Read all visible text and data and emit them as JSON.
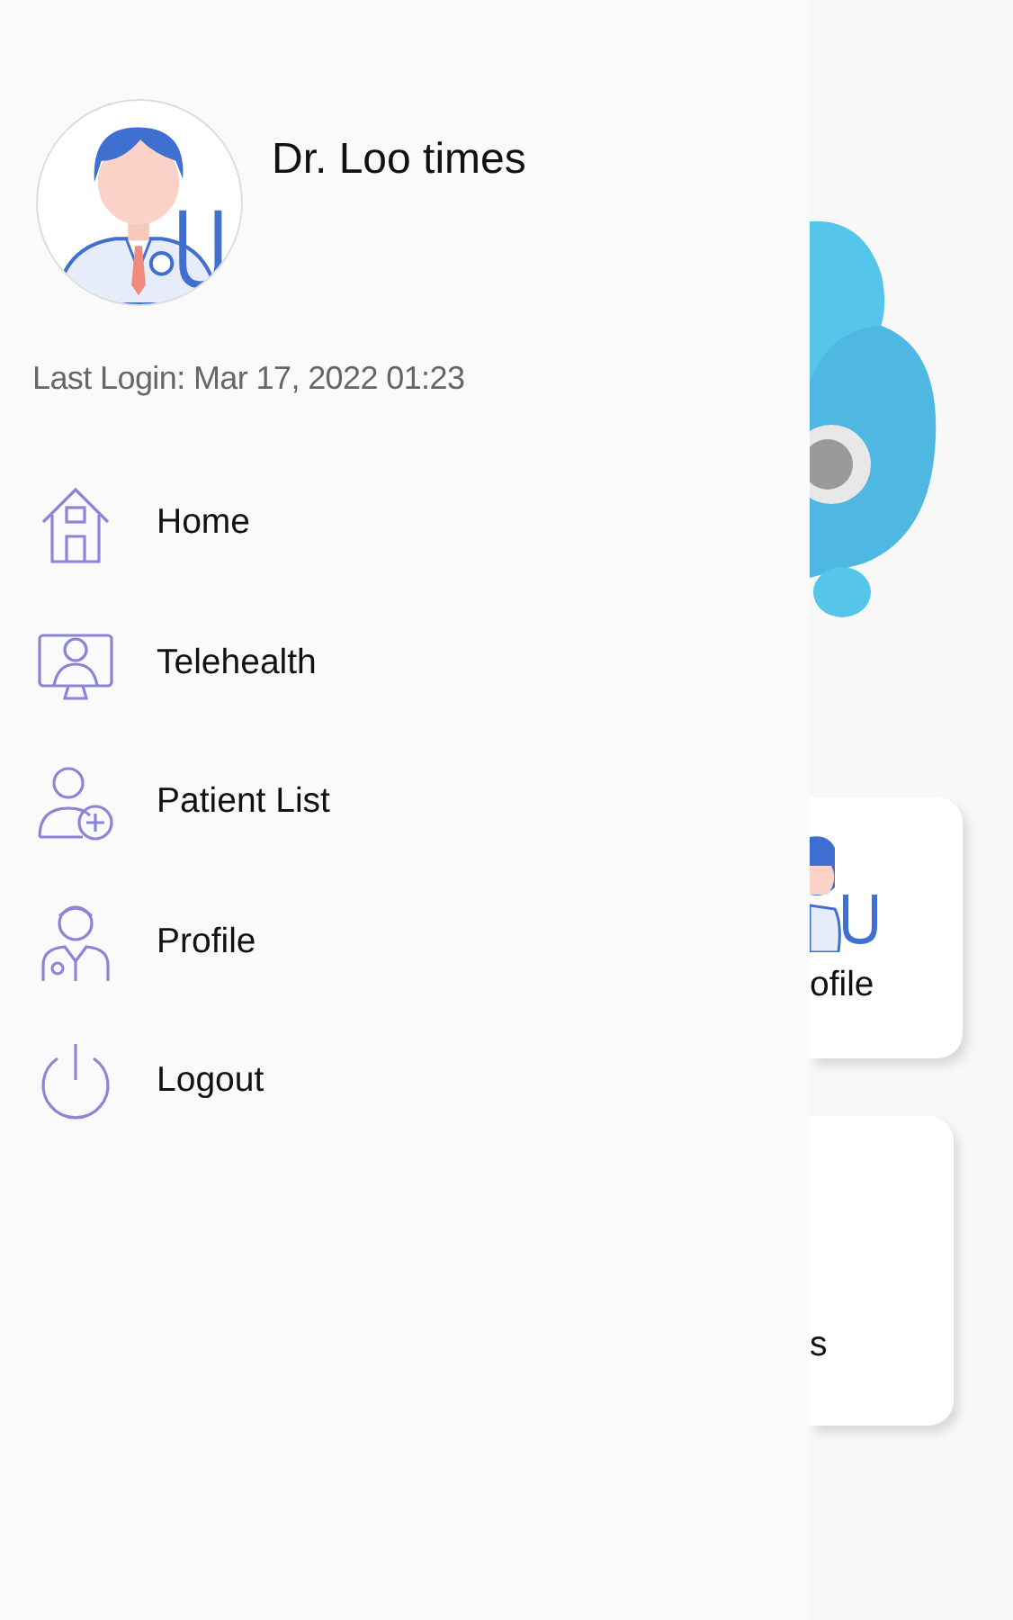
{
  "drawer": {
    "user_name": "Dr. Loo times",
    "last_login": "Last Login: Mar 17, 2022 01:23",
    "menu": [
      {
        "label": "Home",
        "kind": "home"
      },
      {
        "label": "Telehealth",
        "kind": "telehealth"
      },
      {
        "label": "Patient List",
        "kind": "patients"
      },
      {
        "label": "Profile",
        "kind": "profile"
      },
      {
        "label": "Logout",
        "kind": "logout"
      }
    ]
  },
  "background": {
    "cards": [
      {
        "label": "ofile",
        "kind": "doctor"
      },
      {
        "label": "s",
        "kind": "plain"
      }
    ]
  }
}
